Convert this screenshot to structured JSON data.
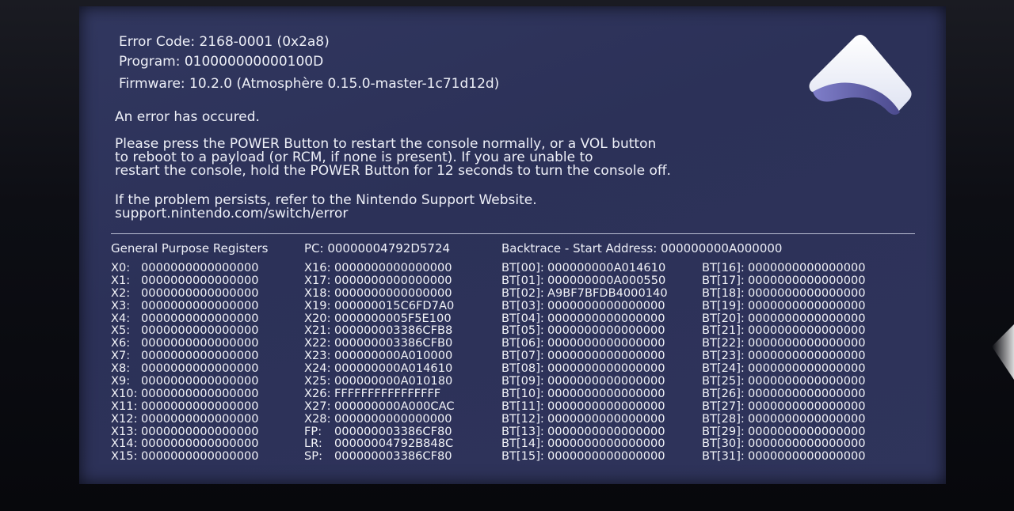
{
  "header": {
    "error_code": "Error Code: 2168-0001 (0x2a8)",
    "program": "Program: 010000000000100D",
    "firmware": "Firmware: 10.2.0 (Atmosphère 0.15.0-master-1c71d12d)"
  },
  "message": {
    "headline": "An error has occured.",
    "instructions": [
      "Please press the POWER Button to restart the console normally, or a VOL button",
      "to reboot to a payload (or RCM, if none is present). If you are unable to",
      "restart the console, hold the POWER Button for 12 seconds to turn the console off."
    ],
    "support_line": "If the problem persists, refer to the Nintendo Support Website.",
    "support_url": "support.nintendo.com/switch/error"
  },
  "columns": {
    "gpr_title": "General Purpose Registers",
    "pc": "PC:   00000004792D5724",
    "backtrace_title": "Backtrace - Start Address: 000000000A000000"
  },
  "registers_left": [
    {
      "label": "X0:",
      "value": "0000000000000000"
    },
    {
      "label": "X1:",
      "value": "0000000000000000"
    },
    {
      "label": "X2:",
      "value": "0000000000000000"
    },
    {
      "label": "X3:",
      "value": "0000000000000000"
    },
    {
      "label": "X4:",
      "value": "0000000000000000"
    },
    {
      "label": "X5:",
      "value": "0000000000000000"
    },
    {
      "label": "X6:",
      "value": "0000000000000000"
    },
    {
      "label": "X7:",
      "value": "0000000000000000"
    },
    {
      "label": "X8:",
      "value": "0000000000000000"
    },
    {
      "label": "X9:",
      "value": "0000000000000000"
    },
    {
      "label": "X10:",
      "value": "0000000000000000"
    },
    {
      "label": "X11:",
      "value": "0000000000000000"
    },
    {
      "label": "X12:",
      "value": "0000000000000000"
    },
    {
      "label": "X13:",
      "value": "0000000000000000"
    },
    {
      "label": "X14:",
      "value": "0000000000000000"
    },
    {
      "label": "X15:",
      "value": "0000000000000000"
    }
  ],
  "registers_right": [
    {
      "label": "X16:",
      "value": "0000000000000000"
    },
    {
      "label": "X17:",
      "value": "0000000000000000"
    },
    {
      "label": "X18:",
      "value": "0000000000000000"
    },
    {
      "label": "X19:",
      "value": "000000015C6FD7A0"
    },
    {
      "label": "X20:",
      "value": "0000000005F5E100"
    },
    {
      "label": "X21:",
      "value": "000000003386CFB8"
    },
    {
      "label": "X22:",
      "value": "000000003386CFB0"
    },
    {
      "label": "X23:",
      "value": "000000000A010000"
    },
    {
      "label": "X24:",
      "value": "000000000A014610"
    },
    {
      "label": "X25:",
      "value": "000000000A010180"
    },
    {
      "label": "X26:",
      "value": "FFFFFFFFFFFFFFFF"
    },
    {
      "label": "X27:",
      "value": "000000000A000CAC"
    },
    {
      "label": "X28:",
      "value": "0000000000000000"
    },
    {
      "label": "FP:",
      "value": "000000003386CF80"
    },
    {
      "label": "LR:",
      "value": "00000004792B848C"
    },
    {
      "label": "SP:",
      "value": "000000003386CF80"
    }
  ],
  "backtrace_left": [
    {
      "label": "BT[00]:",
      "value": "000000000A014610"
    },
    {
      "label": "BT[01]:",
      "value": "000000000A000550"
    },
    {
      "label": "BT[02]:",
      "value": "A9BF7BFDB4000140"
    },
    {
      "label": "BT[03]:",
      "value": "0000000000000000"
    },
    {
      "label": "BT[04]:",
      "value": "0000000000000000"
    },
    {
      "label": "BT[05]:",
      "value": "0000000000000000"
    },
    {
      "label": "BT[06]:",
      "value": "0000000000000000"
    },
    {
      "label": "BT[07]:",
      "value": "0000000000000000"
    },
    {
      "label": "BT[08]:",
      "value": "0000000000000000"
    },
    {
      "label": "BT[09]:",
      "value": "0000000000000000"
    },
    {
      "label": "BT[10]:",
      "value": "0000000000000000"
    },
    {
      "label": "BT[11]:",
      "value": "0000000000000000"
    },
    {
      "label": "BT[12]:",
      "value": "0000000000000000"
    },
    {
      "label": "BT[13]:",
      "value": "0000000000000000"
    },
    {
      "label": "BT[14]:",
      "value": "0000000000000000"
    },
    {
      "label": "BT[15]:",
      "value": "0000000000000000"
    }
  ],
  "backtrace_right": [
    {
      "label": "BT[16]:",
      "value": "0000000000000000"
    },
    {
      "label": "BT[17]:",
      "value": "0000000000000000"
    },
    {
      "label": "BT[18]:",
      "value": "0000000000000000"
    },
    {
      "label": "BT[19]:",
      "value": "0000000000000000"
    },
    {
      "label": "BT[20]:",
      "value": "0000000000000000"
    },
    {
      "label": "BT[21]:",
      "value": "0000000000000000"
    },
    {
      "label": "BT[22]:",
      "value": "0000000000000000"
    },
    {
      "label": "BT[23]:",
      "value": "0000000000000000"
    },
    {
      "label": "BT[24]:",
      "value": "0000000000000000"
    },
    {
      "label": "BT[25]:",
      "value": "0000000000000000"
    },
    {
      "label": "BT[26]:",
      "value": "0000000000000000"
    },
    {
      "label": "BT[27]:",
      "value": "0000000000000000"
    },
    {
      "label": "BT[28]:",
      "value": "0000000000000000"
    },
    {
      "label": "BT[29]:",
      "value": "0000000000000000"
    },
    {
      "label": "BT[30]:",
      "value": "0000000000000000"
    },
    {
      "label": "BT[31]:",
      "value": "0000000000000000"
    }
  ],
  "icons": {
    "logo": "atmosphere-logo-icon"
  },
  "colors": {
    "screen_bg": "#2e3359",
    "text": "#eef0f8",
    "divider": "#b9bdd2"
  }
}
